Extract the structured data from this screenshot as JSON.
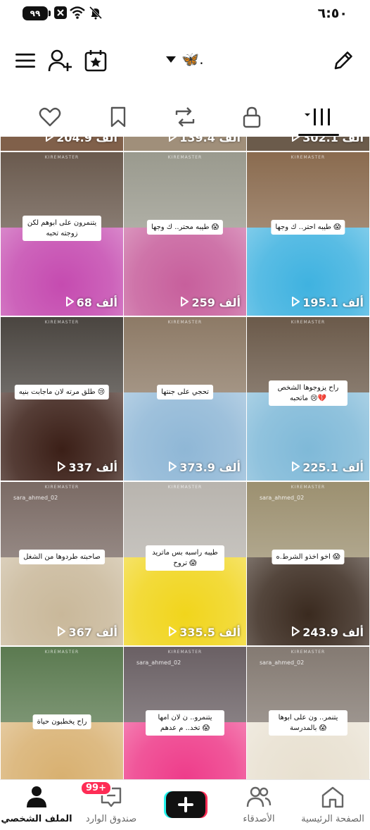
{
  "status_bar": {
    "battery": "٩٩",
    "time": "٦:٥٠"
  },
  "header": {
    "username": "🦋."
  },
  "tabs": [
    "liked",
    "favorites",
    "reposts",
    "private",
    "videos"
  ],
  "partial_row_views": [
    "302.1 ألف",
    "139.4 ألف",
    "204.9 ألف"
  ],
  "videos": [
    {
      "caption": "طيبه احتر.. ك وجها 😱",
      "views": "195.1 ألف",
      "top": "#8a6b4f",
      "bottom": "#3fb2e0",
      "tall": false
    },
    {
      "caption": "طيبه محتر.. ك وجها 😱",
      "views": "259 ألف",
      "top": "#9a9a8e",
      "bottom": "#c75f9c",
      "tall": false
    },
    {
      "caption": "يتنمرون على ابوهم لكن زوجته تحبه",
      "views": "68 ألف",
      "top": "#6a5a4e",
      "bottom": "#c54bb0",
      "tall": true
    },
    {
      "caption": "راح يزوجوها الشخص ماتحبه 😢💔",
      "views": "225.1 ألف",
      "top": "#6b5a4a",
      "bottom": "#7fb9d8",
      "tall": true
    },
    {
      "caption": "تحجي على جنتها",
      "views": "373.9 ألف",
      "top": "#8d7a66",
      "bottom": "#8fb7d6",
      "tall": false
    },
    {
      "caption": "طلق مرته لان ماجابت بنيه 😢",
      "views": "337 ألف",
      "top": "#4a4540",
      "bottom": "#3b1f17",
      "tall": false
    },
    {
      "caption": "اخو اخذو الشرط.ه 😱",
      "views": "243.9 ألف",
      "top": "#9c9070",
      "bottom": "#3a2a1f",
      "tall": false
    },
    {
      "caption": "طيبه راسبه بس ماتريد تروح 😱",
      "views": "335.5 ألف",
      "top": "#b8b4ae",
      "bottom": "#f1d51c",
      "tall": true
    },
    {
      "caption": "صاحبته طردوها من الشغل",
      "views": "367 ألف",
      "top": "#7a6a64",
      "bottom": "#c9b89a",
      "tall": false
    },
    {
      "caption": "يتنمر.. ون على ابوها بالمدرسة 😱",
      "views": "",
      "top": "#847a72",
      "bottom": "#e8e0d0",
      "tall": true
    },
    {
      "caption": "يتنمرو.. ن لان امها تخد.. م عدهم 😱",
      "views": "",
      "top": "#6a6064",
      "bottom": "#ee3c8a",
      "tall": true
    },
    {
      "caption": "راح يخطبون حياة",
      "views": "",
      "top": "#5b7a50",
      "bottom": "#d8b070",
      "tall": false
    }
  ],
  "watermark": "KIREMASTER",
  "tag_text": "sara_ahmed_02",
  "bottom_nav": {
    "home": "الصفحة الرئيسية",
    "friends": "الأصدقاء",
    "inbox": "صندوق الوارد",
    "profile": "الملف الشخصي",
    "inbox_badge": "99+"
  },
  "colors": {
    "accent": "#fe2c55",
    "cyan": "#25f4ee"
  }
}
